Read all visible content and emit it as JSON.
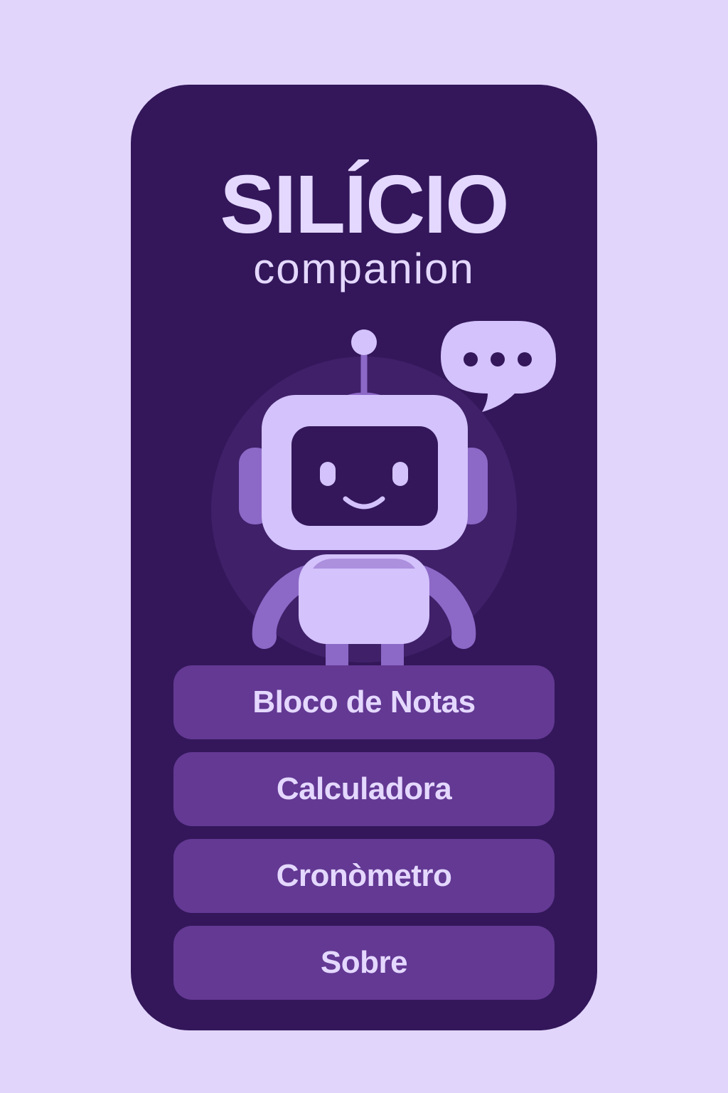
{
  "app": {
    "title": "SILÍCIO",
    "subtitle": "companion"
  },
  "mascot": {
    "icon": "robot-icon",
    "speech_icon": "speech-bubble-icon"
  },
  "menu": {
    "items": [
      {
        "label": "Bloco de Notas",
        "icon": "notepad"
      },
      {
        "label": "Calculadora",
        "icon": "calculator"
      },
      {
        "label": "Cronòmetro",
        "icon": "stopwatch"
      },
      {
        "label": "Sobre",
        "icon": "info"
      }
    ]
  },
  "colors": {
    "page_background": "#e2d5fc",
    "panel_background": "#33175a",
    "button_background": "#633993",
    "text": "#e4d8ff",
    "robot_light": "#d3c2fb",
    "robot_mid": "#8c68c7",
    "robot_halo": "#3f2069"
  }
}
